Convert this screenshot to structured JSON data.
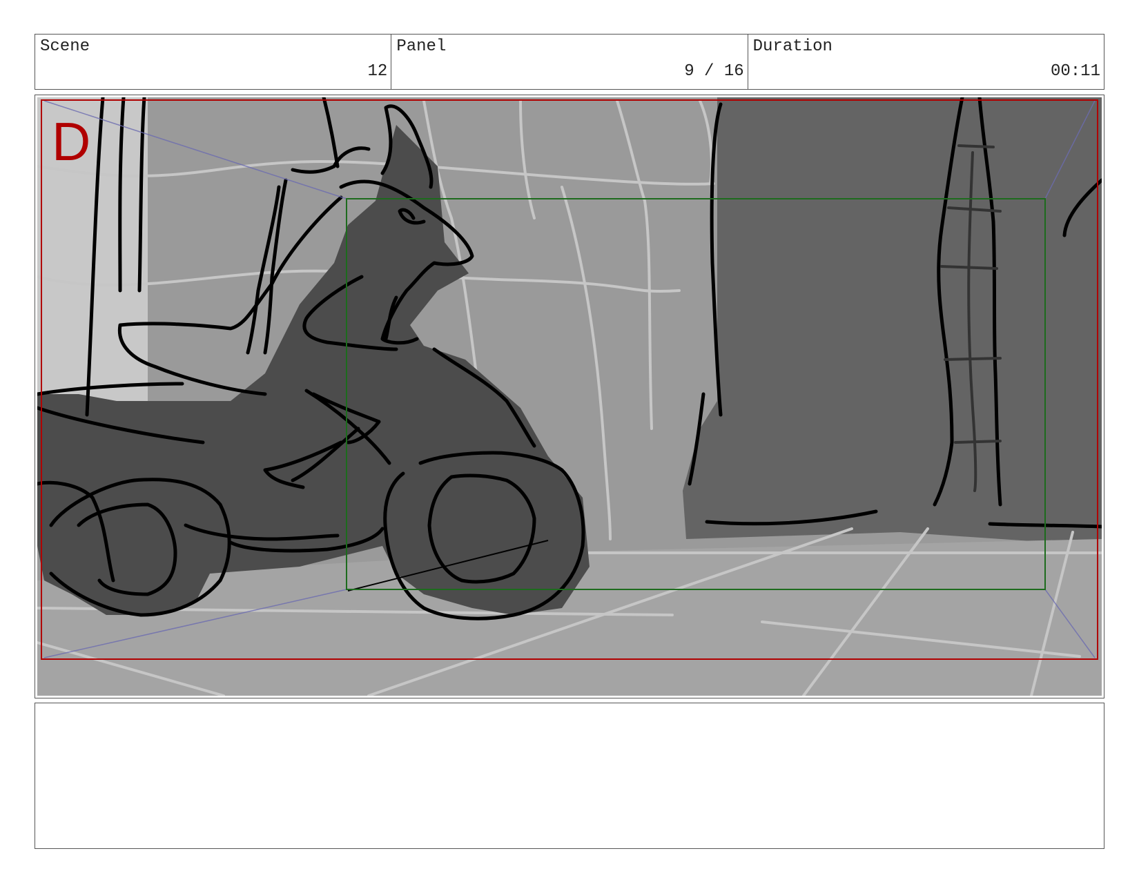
{
  "header": {
    "scene_label": "Scene",
    "scene_value": "12",
    "panel_label": "Panel",
    "panel_value": "9 / 16",
    "duration_label": "Duration",
    "duration_value": "00:11"
  },
  "frame": {
    "panel_letter": "D",
    "safe_frame_color": "#b00000",
    "camera_frame_color": "#1d6b1d",
    "guide_color": "#6b6bb0"
  },
  "notes": {
    "text": ""
  }
}
